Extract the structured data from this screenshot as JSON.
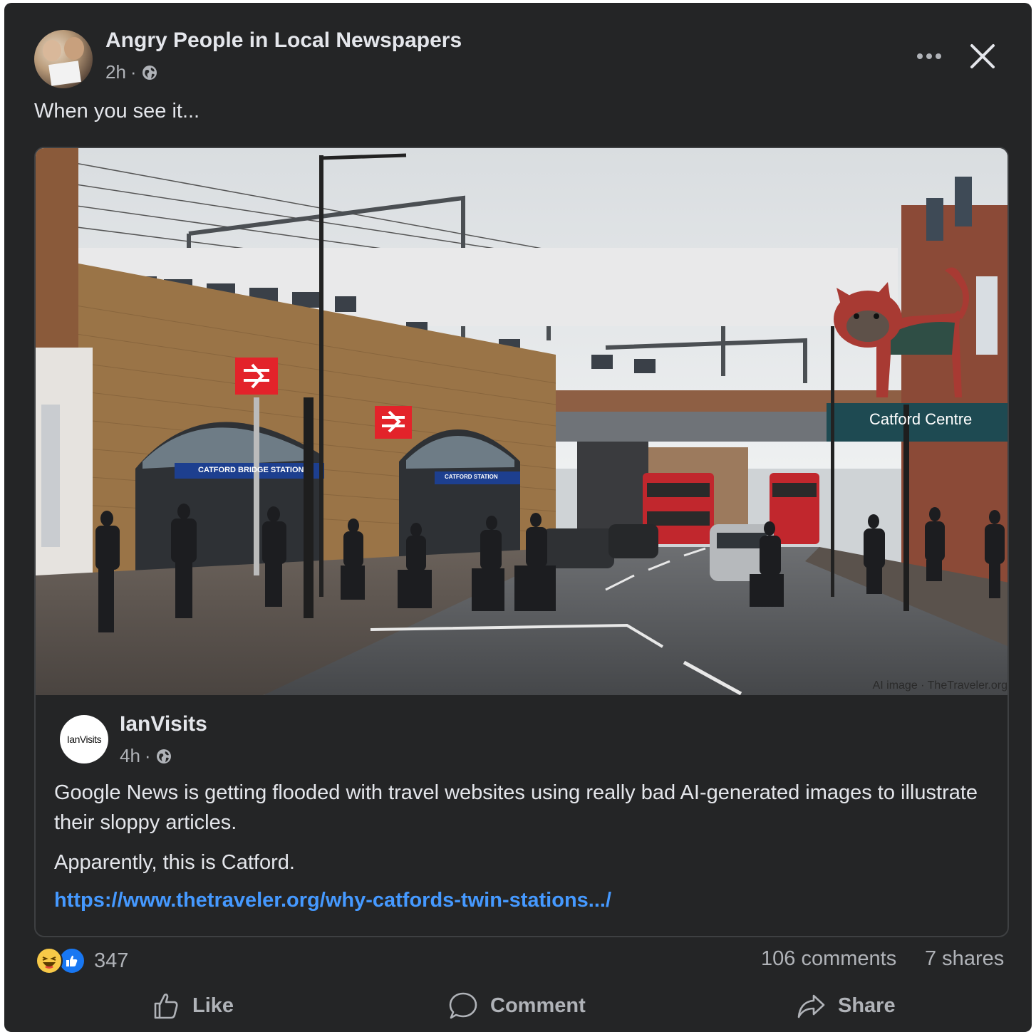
{
  "post": {
    "group_name": "Angry People in Local Newspapers",
    "time": "2h",
    "separator": "·",
    "text": "When you see it..."
  },
  "icons": {
    "more": "more-options-icon",
    "close": "close-icon",
    "audience": "globe-icon"
  },
  "shared": {
    "author": "IanVisits",
    "avatar_text": "IanVisits",
    "time": "4h",
    "separator": "·",
    "paragraph1": "Google News is getting flooded with travel websites using really bad AI-generated images to illustrate their sloppy articles.",
    "paragraph2": "Apparently, this is Catford.",
    "link": "https://www.thetraveler.org/why-catfords-twin-stations.../"
  },
  "photo": {
    "credit": "AI image · TheTraveler.org",
    "sign_catford_centre": "Catford Centre",
    "sign_station_left": "CATFORD BRIDGE STATION",
    "sign_station_right": "CATFORD STATION"
  },
  "stats": {
    "reaction_count": "347",
    "comments": "106 comments",
    "shares": "7 shares"
  },
  "actions": {
    "like": "Like",
    "comment": "Comment",
    "share": "Share"
  },
  "colors": {
    "background": "#242526",
    "text_primary": "#e4e6eb",
    "text_secondary": "#b0b3b8",
    "link": "#4599ff",
    "like_blue": "#1877f2",
    "haha_yellow": "#f7c948"
  }
}
